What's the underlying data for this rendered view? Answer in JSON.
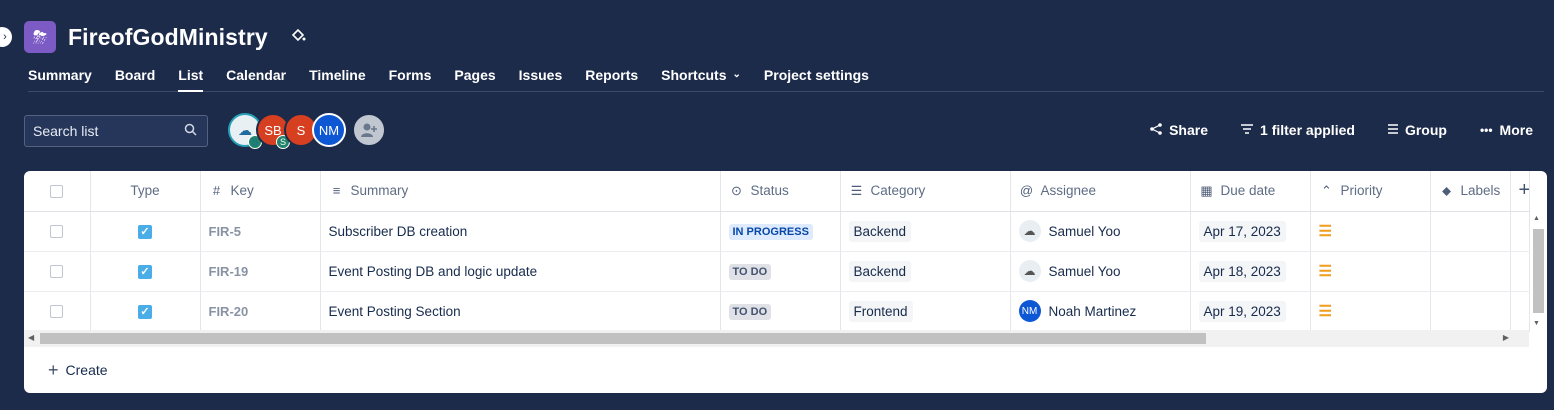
{
  "project": {
    "title": "FireofGodMinistry"
  },
  "tabs": [
    {
      "label": "Summary"
    },
    {
      "label": "Board"
    },
    {
      "label": "List"
    },
    {
      "label": "Calendar"
    },
    {
      "label": "Timeline"
    },
    {
      "label": "Forms"
    },
    {
      "label": "Pages"
    },
    {
      "label": "Issues"
    },
    {
      "label": "Reports"
    },
    {
      "label": "Shortcuts"
    },
    {
      "label": "Project settings"
    }
  ],
  "active_tab": "List",
  "search": {
    "placeholder": "Search list"
  },
  "avatars": [
    {
      "initials": "",
      "badge": "S"
    },
    {
      "initials": "SB",
      "badge": "S"
    },
    {
      "initials": "S"
    },
    {
      "initials": "NM"
    }
  ],
  "actions": {
    "share": "Share",
    "filter": "1 filter applied",
    "group": "Group",
    "more": "More"
  },
  "table": {
    "headers": {
      "type": "Type",
      "key": "Key",
      "summary": "Summary",
      "status": "Status",
      "category": "Category",
      "assignee": "Assignee",
      "due": "Due date",
      "priority": "Priority",
      "labels": "Labels"
    },
    "rows": [
      {
        "key": "FIR-5",
        "summary": "Subscriber DB creation",
        "status": "IN PROGRESS",
        "category": "Backend",
        "assignee": "Samuel Yoo",
        "assignee_initials": "",
        "due": "Apr 17, 2023",
        "priority": "Medium"
      },
      {
        "key": "FIR-19",
        "summary": "Event Posting DB and logic update",
        "status": "TO DO",
        "category": "Backend",
        "assignee": "Samuel Yoo",
        "assignee_initials": "",
        "due": "Apr 18, 2023",
        "priority": "Medium"
      },
      {
        "key": "FIR-20",
        "summary": "Event Posting Section",
        "status": "TO DO",
        "category": "Frontend",
        "assignee": "Noah Martinez",
        "assignee_initials": "NM",
        "due": "Apr 19, 2023",
        "priority": "Medium"
      }
    ]
  },
  "create_label": "Create",
  "colors": {
    "background": "#1d2b4a",
    "panel": "#ffffff",
    "in_progress": "#deebff",
    "todo": "#dfe1e6",
    "priority_medium": "#f29c1f",
    "project_icon": "#7c5cc4"
  }
}
